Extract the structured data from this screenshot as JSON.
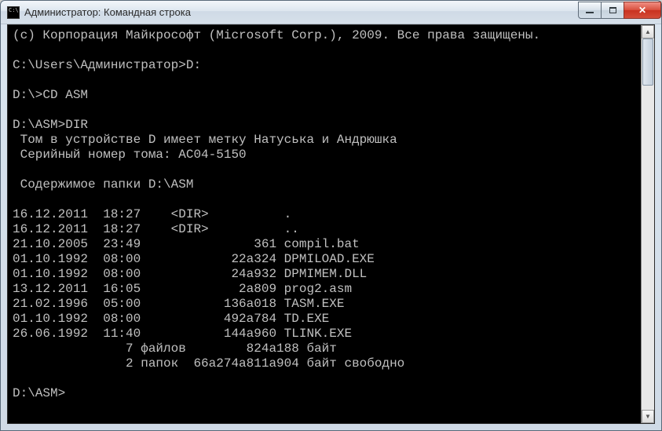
{
  "window": {
    "title": "Администратор: Командная строка"
  },
  "terminal": {
    "lines": [
      "(с) Корпорация Майкрософт (Microsoft Corp.), 2009. Все права защищены.",
      "",
      "C:\\Users\\Администратор>D:",
      "",
      "D:\\>CD ASM",
      "",
      "D:\\ASM>DIR",
      " Том в устройстве D имеет метку Натуська и Андрюшка",
      " Серийный номер тома: AC04-5150",
      "",
      " Содержимое папки D:\\ASM",
      "",
      "16.12.2011  18:27    <DIR>          .",
      "16.12.2011  18:27    <DIR>          ..",
      "21.10.2005  23:49               361 compil.bat",
      "01.10.1992  08:00            22а324 DPMILOAD.EXE",
      "01.10.1992  08:00            24а932 DPMIMEM.DLL",
      "13.12.2011  16:05             2а809 prog2.asm",
      "21.02.1996  05:00           136а018 TASM.EXE",
      "01.10.1992  08:00           492а784 TD.EXE",
      "26.06.1992  11:40           144а960 TLINK.EXE",
      "               7 файлов        824а188 байт",
      "               2 папок  66а274а811а904 байт свободно",
      "",
      "D:\\ASM>"
    ]
  }
}
